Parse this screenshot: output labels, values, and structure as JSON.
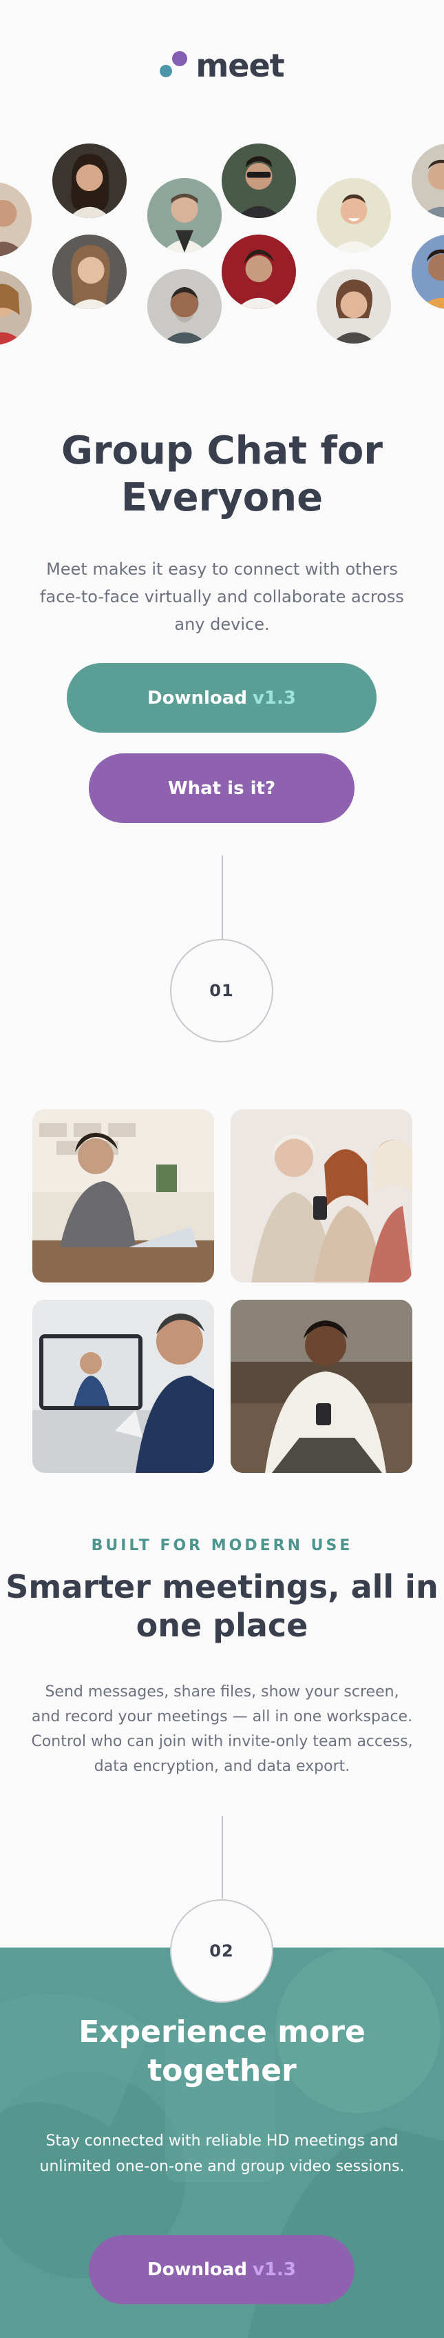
{
  "header": {
    "brand": "meet",
    "colors": {
      "teal": "#4d96a9",
      "purple": "#855fb1"
    }
  },
  "hero": {
    "title": "Group Chat for Everyone",
    "description": "Meet makes it easy to connect with others face-to-face virtually and collaborate across any device.",
    "download_label": "Download",
    "download_version": "v1.3",
    "what_label": "What is it?"
  },
  "steps": {
    "first": "01",
    "second": "02"
  },
  "features": {
    "eyebrow": "BUILT FOR MODERN USE",
    "title": "Smarter meetings, all in one place",
    "description": "Send messages, share files, show your screen, and record your meetings — all in one workspace. Control who can join with invite-only team access, data encryption, and data export."
  },
  "cta": {
    "title": "Experience more together",
    "description": "Stay connected with reliable HD meetings and unlimited one-on-one and group video sessions.",
    "download_label": "Download",
    "download_version": "v1.3"
  },
  "theme": {
    "teal": "#5a9e96",
    "purple": "#8f62b0",
    "text": "#3a3f4e",
    "muted": "#6e7280"
  }
}
